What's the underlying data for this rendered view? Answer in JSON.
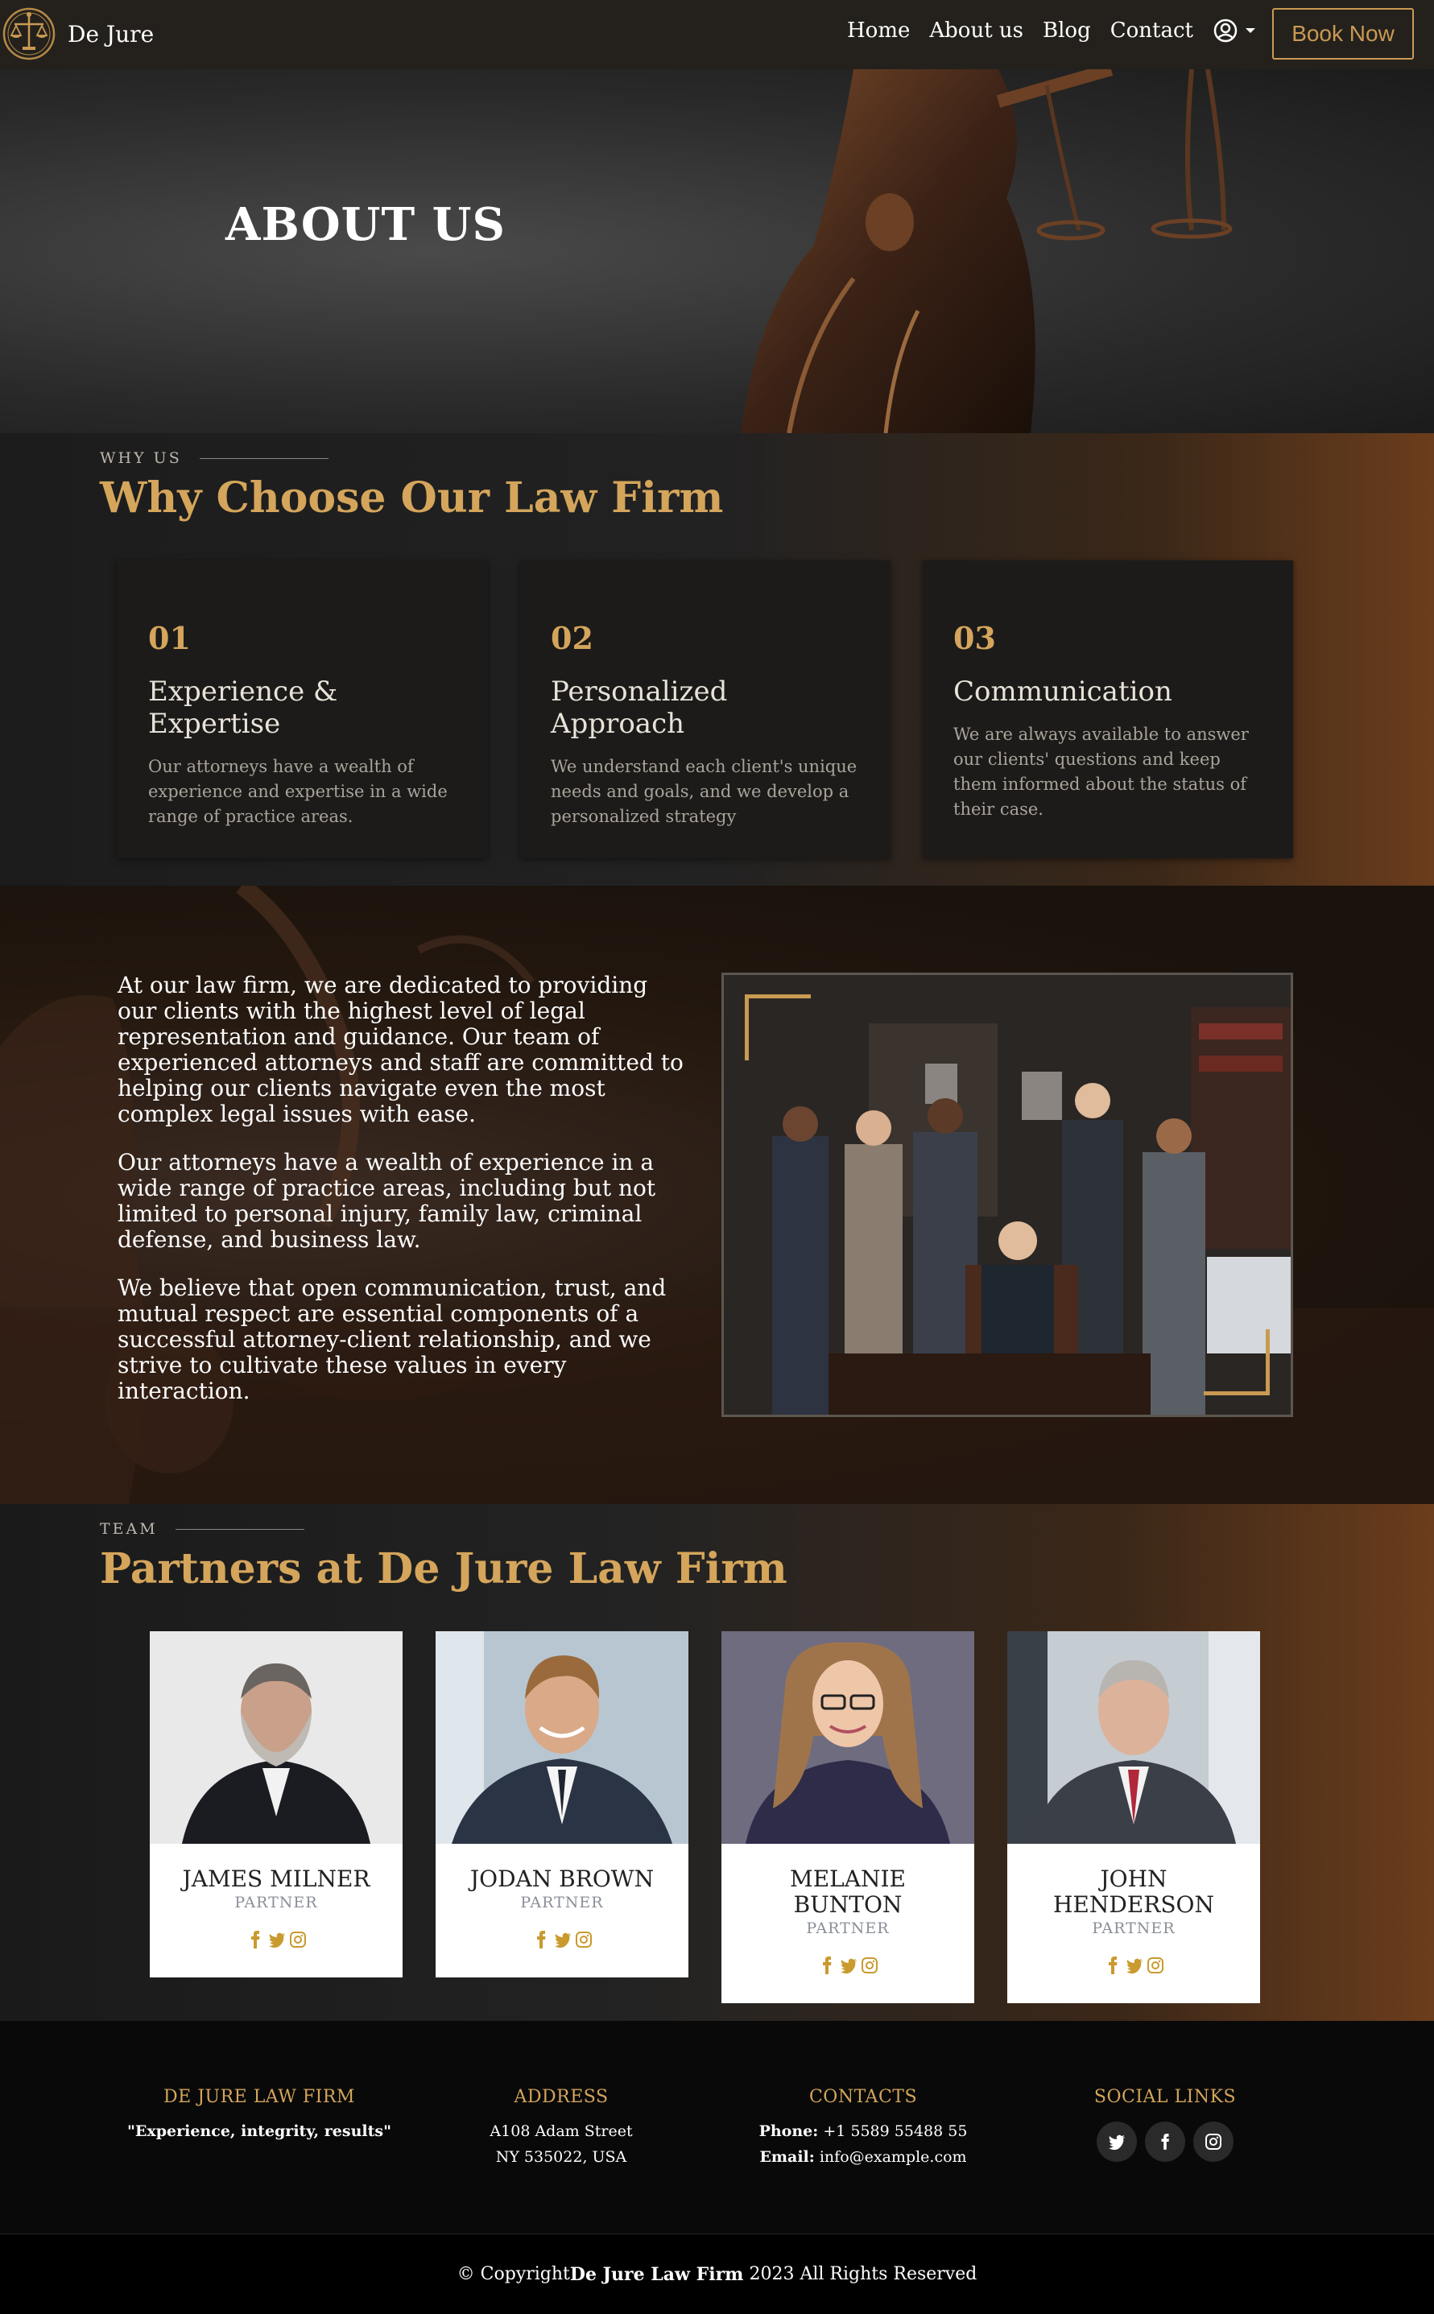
{
  "nav": {
    "brand": "De Jure",
    "links": [
      "Home",
      "About us",
      "Blog",
      "Contact"
    ],
    "book_label": "Book Now"
  },
  "hero": {
    "title": "ABOUT US"
  },
  "why": {
    "eyebrow": "WHY US",
    "title": "Why Choose Our Law Firm",
    "cards": [
      {
        "num": "01",
        "title": "Experience & Expertise",
        "desc": "Our attorneys have a wealth of experience and expertise in a wide range of practice areas."
      },
      {
        "num": "02",
        "title": "Personalized Approach",
        "desc": "We understand each client's unique needs and goals, and we develop a personalized strategy"
      },
      {
        "num": "03",
        "title": "Communication",
        "desc": "We are always available to answer our clients' questions and keep them informed about the status of their case."
      }
    ]
  },
  "about": {
    "paragraphs": [
      "At our law firm, we are dedicated to providing our clients with the highest level of legal representation and guidance. Our team of experienced attorneys and staff are committed to helping our clients navigate even the most complex legal issues with ease.",
      "Our attorneys have a wealth of experience in a wide range of practice areas, including but not limited to personal injury, family law, criminal defense, and business law.",
      "We believe that open communication, trust, and mutual respect are essential components of a successful attorney-client relationship, and we strive to cultivate these values in every interaction."
    ]
  },
  "team": {
    "eyebrow": "TEAM",
    "title": "Partners at De Jure Law Firm",
    "members": [
      {
        "name": "JAMES MILNER",
        "role": "PARTNER"
      },
      {
        "name": "JODAN BROWN",
        "role": "PARTNER"
      },
      {
        "name": "MELANIE BUNTON",
        "role": "PARTNER"
      },
      {
        "name": "JOHN HENDERSON",
        "role": "PARTNER"
      }
    ]
  },
  "footer": {
    "firm_heading": "DE JURE LAW FIRM",
    "tagline": "\"Experience, integrity, results\"",
    "address_heading": "ADDRESS",
    "address_line1": "A108 Adam Street",
    "address_line2": "NY 535022, USA",
    "contacts_heading": "CONTACTS",
    "phone_label": "Phone:",
    "phone": "+1 5589 55488 55",
    "email_label": "Email:",
    "email": "info@example.com",
    "social_heading": "SOCIAL LINKS",
    "copyright_prefix": "© Copyright",
    "copyright_firm": "De Jure Law Firm",
    "copyright_suffix": " 2023 All Rights Reserved"
  },
  "colors": {
    "gold": "#d4a55b",
    "nav_bg": "#24211d",
    "footer_bg": "#090909"
  },
  "icons": [
    "scales-logo",
    "user-circle-icon",
    "caret-down-icon",
    "facebook-icon",
    "twitter-icon",
    "instagram-icon"
  ]
}
